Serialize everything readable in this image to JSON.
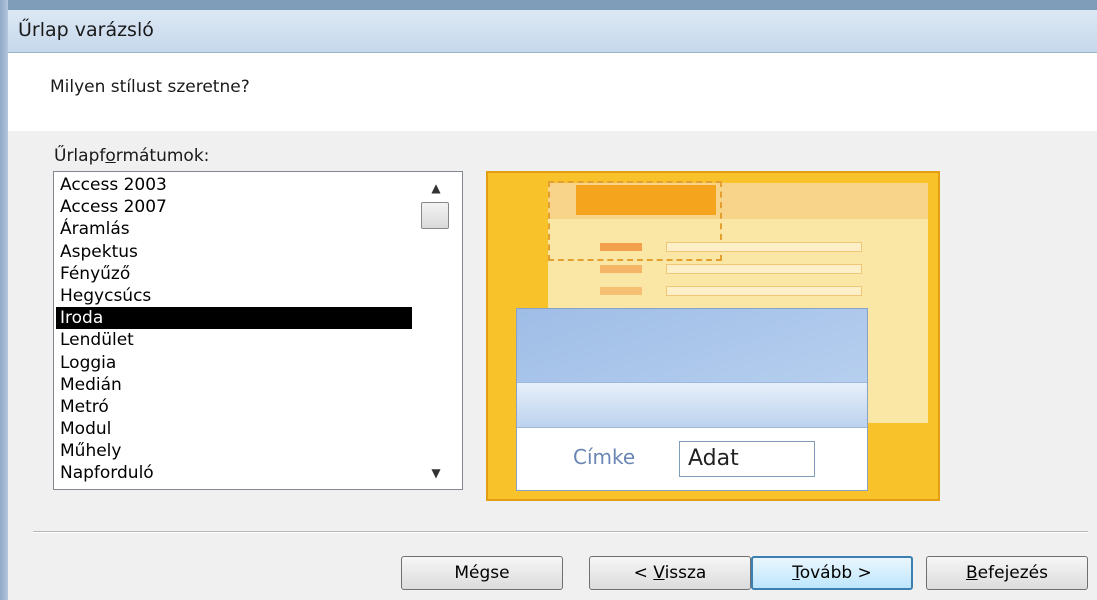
{
  "window": {
    "title": "Űrlap varázsló"
  },
  "header": {
    "question": "Milyen stílust szeretne?"
  },
  "list": {
    "label_before": "Űrlapf",
    "label_mnemonic": "o",
    "label_after": "rmátumok:",
    "items": [
      "Access 2003",
      "Access 2007",
      "Áramlás",
      "Aspektus",
      "Fényűző",
      "Hegycsúcs",
      "Iroda",
      "Lendület",
      "Loggia",
      "Medián",
      "Metró",
      "Modul",
      "Műhely",
      "Napforduló"
    ],
    "selected": "Iroda",
    "scroll_up_glyph": "▲",
    "scroll_down_glyph": "▼"
  },
  "preview": {
    "label": "Címke",
    "field": "Adat"
  },
  "buttons": {
    "cancel": "Mégse",
    "back_prefix": "< ",
    "back_mnemonic": "V",
    "back_rest": "issza",
    "next_mnemonic": "T",
    "next_rest": "ovább >",
    "finish_mnemonic": "B",
    "finish_rest": "efejezés"
  },
  "colors": {
    "selection": "#000000",
    "preview_accent": "#f7c22a",
    "default_button_border": "#3c7fb1"
  }
}
